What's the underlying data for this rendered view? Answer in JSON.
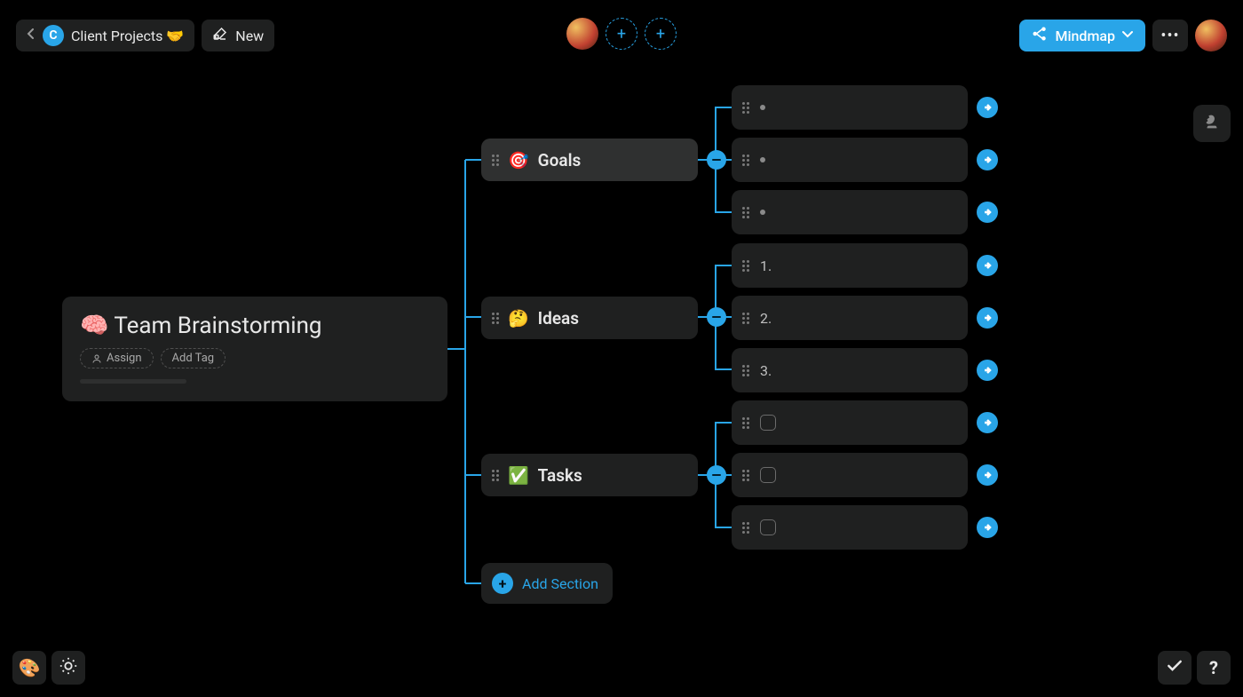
{
  "header": {
    "workspace_initial": "C",
    "breadcrumb_label": "Client Projects 🤝",
    "new_label": "New",
    "view_mode_label": "Mindmap"
  },
  "root": {
    "emoji": "🧠",
    "title": "Team Brainstorming",
    "assign_label": "Assign",
    "add_tag_label": "Add Tag"
  },
  "sections": [
    {
      "emoji": "🎯",
      "label": "Goals",
      "type": "bullet",
      "items": [
        "",
        "",
        ""
      ]
    },
    {
      "emoji": "🤔",
      "label": "Ideas",
      "type": "numbered",
      "items": [
        "1.",
        "2.",
        "3."
      ]
    },
    {
      "emoji": "✅",
      "label": "Tasks",
      "type": "checkbox",
      "items": [
        "",
        "",
        ""
      ]
    }
  ],
  "add_section_label": "Add Section",
  "icons": {
    "collapse_symbol": "−",
    "add_symbol": "+"
  }
}
